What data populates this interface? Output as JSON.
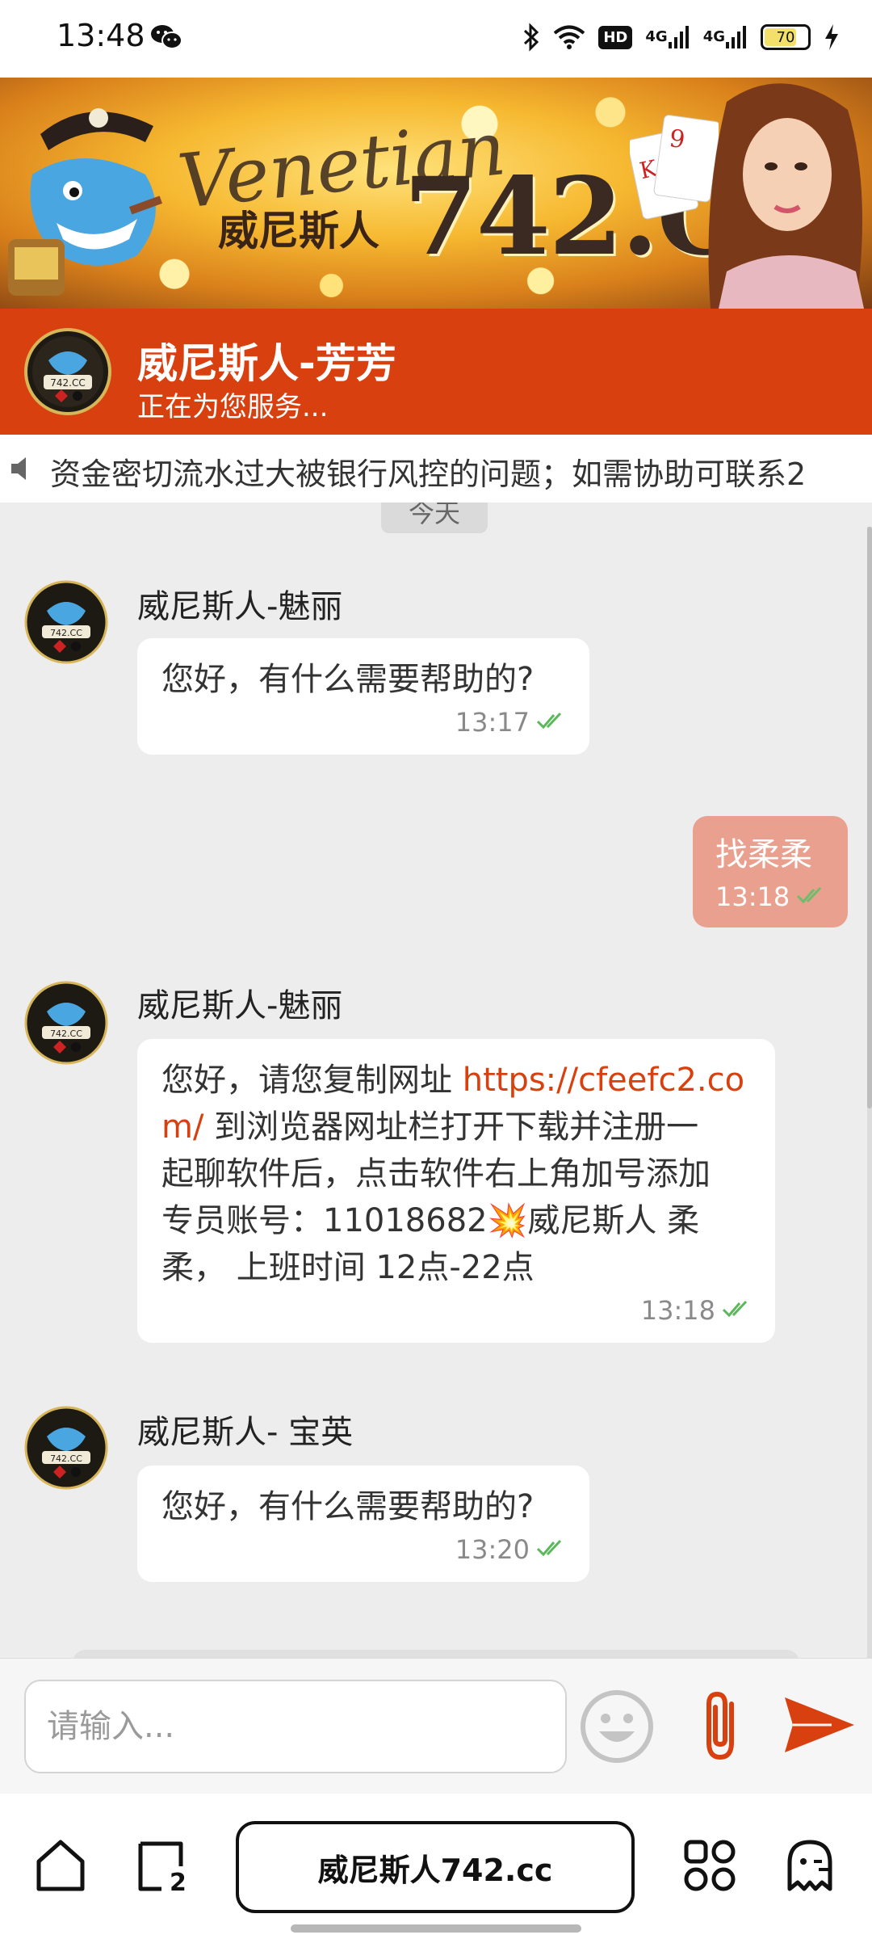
{
  "status_bar": {
    "time": "13:48",
    "hd_label": "HD",
    "net1_label": "4G",
    "net2_label": "4G",
    "battery_level": "70",
    "icons": [
      "wechat-icon",
      "bluetooth-icon",
      "wifi-icon",
      "signal-icon",
      "charging-icon"
    ]
  },
  "banner": {
    "script_text": "Venetian",
    "cn_text": "威尼斯人",
    "number_text": "742.CC",
    "colors": {
      "gold": "#f6b830",
      "brown": "#3b2a22"
    }
  },
  "header": {
    "agent_name": "威尼斯人-芳芳",
    "agent_status": "正在为您服务...",
    "color": "#d9400f"
  },
  "marquee": {
    "text": "资金密切流水过大被银行风控的问题；如需协助可联系2"
  },
  "chat": {
    "date_label": "今天",
    "messages": [
      {
        "direction": "in",
        "sender": "威尼斯人-魅丽",
        "text": "您好，有什么需要帮助的?",
        "time": "13:17"
      },
      {
        "direction": "out",
        "text": "找柔柔",
        "time": "13:18"
      },
      {
        "direction": "in",
        "sender": "威尼斯人-魅丽",
        "text_prefix": "您好，请您复制网址 ",
        "link_part1": "https://cfeefc2.co",
        "link_part2": "m/",
        "text_line2": " 到浏览器网址栏打开下载并注册一",
        "text_line3": "起聊软件后，点击软件右上角加号添加",
        "text_line4": "专员账号：11018682💥威尼斯人  柔",
        "text_line5": "柔，  上班时间  12点-22点",
        "time": "13:18"
      },
      {
        "direction": "in",
        "sender": "威尼斯人- 宝英",
        "text": "您好，有什么需要帮助的?",
        "time": "13:20"
      }
    ]
  },
  "input": {
    "placeholder": "请输入...",
    "icons": [
      "emoji-icon",
      "paperclip-icon",
      "send-icon"
    ],
    "accent_color": "#d9400f"
  },
  "browser": {
    "url_text": "威尼斯人742.cc",
    "tab_count": "2",
    "icons": [
      "home-icon",
      "tabs-icon",
      "apps-grid-icon",
      "ghost-icon"
    ]
  }
}
